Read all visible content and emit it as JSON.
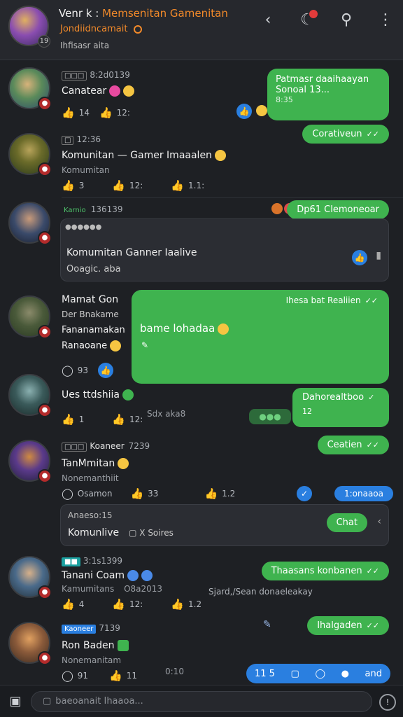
{
  "header": {
    "title_main": "Venr k :",
    "title_orange": "Memsenitan Gamenitan",
    "subtitle": "Jondiidncamait",
    "status": "Ihfisasr aita",
    "avatar_badge": "19"
  },
  "posts": [
    {
      "meta": "8:2d0139",
      "tag": "□□□",
      "name": "Canatear",
      "likes": "14",
      "comments": "12:",
      "bubble1_line1": "Patmasr daaihaayan",
      "bubble1_line2": "Sonoal 13...",
      "bubble1_time": "8:35",
      "bubble2": "Corativeun"
    },
    {
      "meta": "12:36",
      "tag": "□",
      "name": "Komunitan — Gamer Imaaalen",
      "sub": "Komumitan",
      "likes": "3",
      "comments": "12:",
      "shares": "1.1:"
    },
    {
      "meta": "136139",
      "tag": "Karnio",
      "bubble": "Dp61 Clemoneoar",
      "card_title": "Komumitan Ganner Iaalive",
      "card_sub": "Ooagic. aba"
    },
    {
      "name": "Mamat Gon",
      "line2": "Der Bnakame",
      "line3": "Fananamakan",
      "line4": "Ranaoane",
      "counts": "93",
      "bubble_header": "Ihesa bat Realiien",
      "bubble_text": "bame lohadaa"
    },
    {
      "name": "Ues ttdshiia",
      "likes": "1",
      "comments": "12:",
      "side_text": "Sdx aka8",
      "bubble": "Dahorealtboo",
      "bubble_sub": "12"
    },
    {
      "meta": "7239",
      "tag": "□□□",
      "author": "Koaneer",
      "name": "TanMmitan",
      "sub": "Nonemanthiit",
      "pre": "Osamon",
      "likes": "33",
      "shares": "1.2",
      "bubble": "Ceatien",
      "bubble_blue": "1:onaaoa"
    },
    {
      "card_line1": "Anaeso:15",
      "card_line2": "Komunlive",
      "card_extra": "X Soires",
      "chat_button": "Chat"
    },
    {
      "meta": "3:1s1399",
      "tag": "■■",
      "name": "Tanani Coam",
      "sub": "Kamumitans",
      "sub2": "O8a2013",
      "likes": "4",
      "comments": "12:",
      "shares": "1.2",
      "bubble": "Thaasans konbanen",
      "reply": "Sjard,/Sean donaeleakay"
    },
    {
      "meta": "7139",
      "tag": "Kaoneer",
      "name": "Ron Baden",
      "sub": "Nonemanitam",
      "likes": "91",
      "comments": "11",
      "side_text": "0:10",
      "bubble": "Ihalgaden",
      "bar_label": "and",
      "bar_num": "11 5"
    }
  ],
  "composer": {
    "placeholder": "baeoanait Ihaaoa..."
  },
  "colors": {
    "accent_green": "#3fb34f",
    "accent_blue": "#2a7fe0",
    "accent_orange": "#f28a2a"
  }
}
